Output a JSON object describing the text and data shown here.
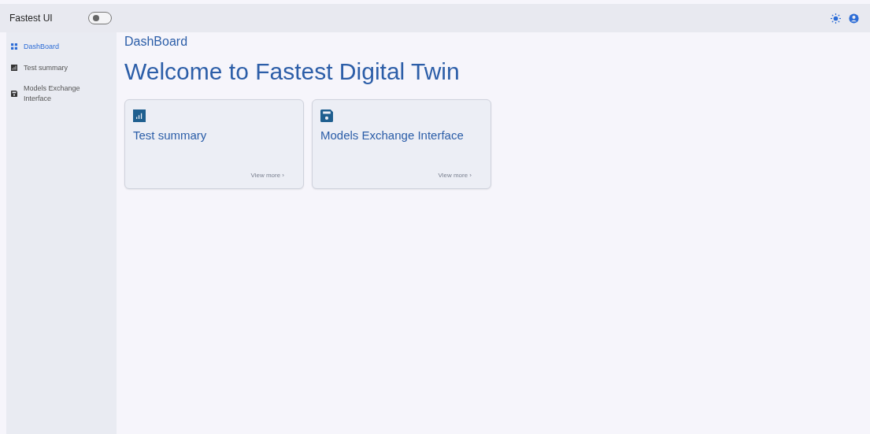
{
  "app_title": "Fastest UI",
  "theme_toggle": {
    "on": false
  },
  "sidebar": {
    "items": [
      {
        "label": "DashBoard",
        "kind": "grid",
        "selected": true
      },
      {
        "label": "Test summary",
        "kind": "chart",
        "selected": false
      },
      {
        "label": "Models Exchange Interface",
        "kind": "disk",
        "selected": false
      }
    ]
  },
  "breadcrumb": "DashBoard",
  "heading": "Welcome to Fastest Digital Twin",
  "cards": [
    {
      "title": "Test summary",
      "kind": "chart",
      "link": "View more",
      "arrow": "›"
    },
    {
      "title": "Models Exchange Interface",
      "kind": "disk",
      "link": "View more",
      "arrow": "›"
    }
  ]
}
